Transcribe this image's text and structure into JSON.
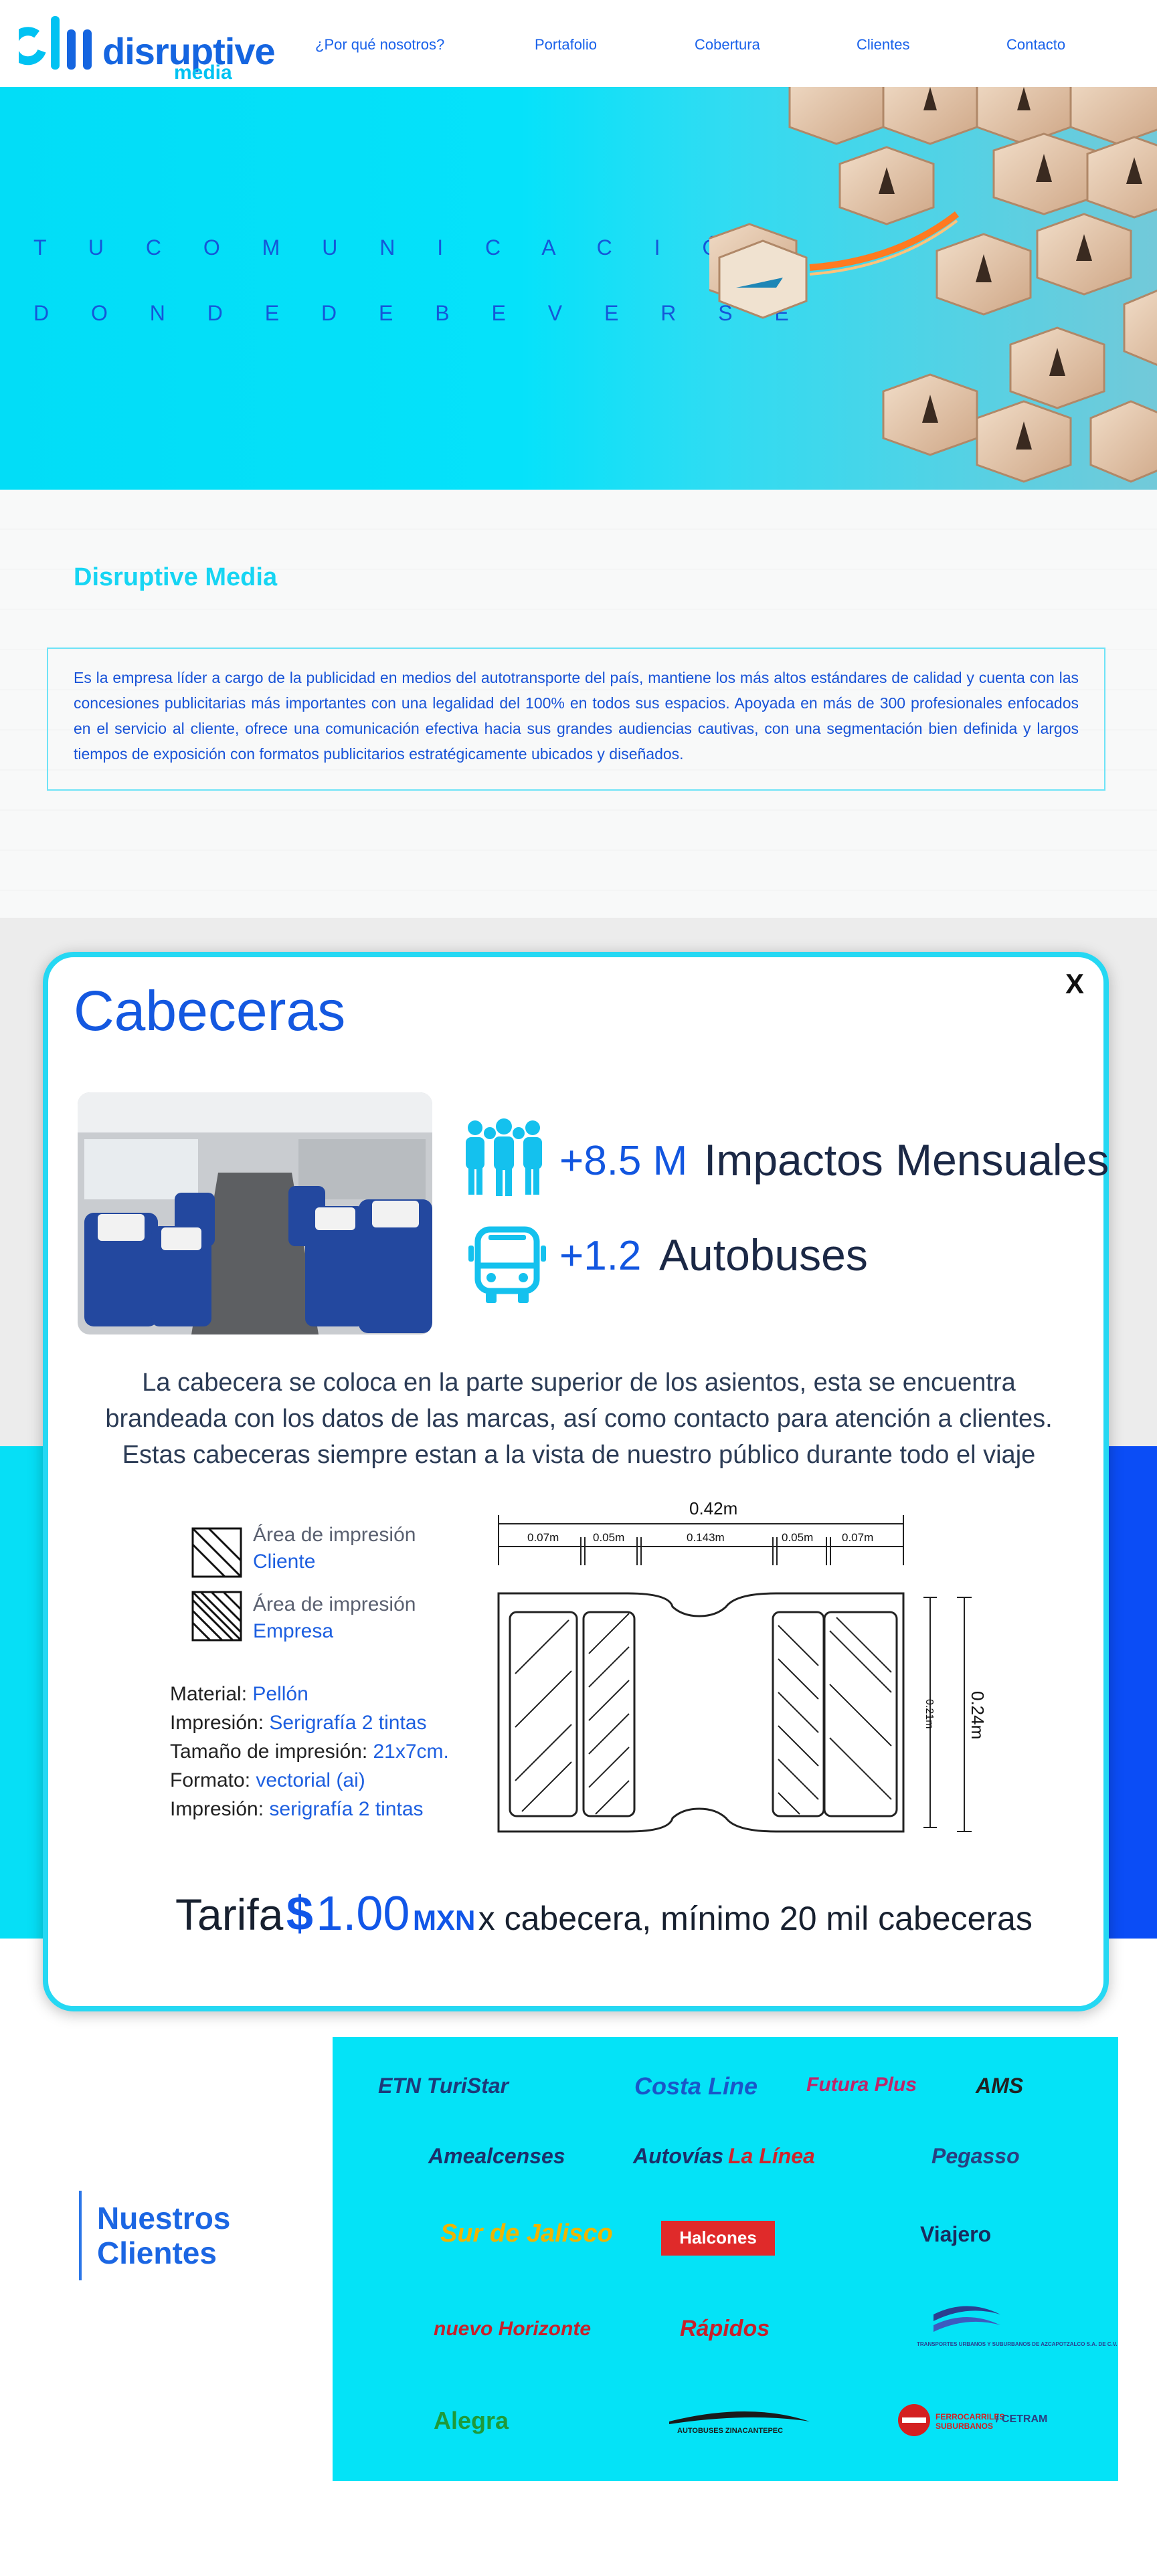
{
  "brand": {
    "name": "disruptive",
    "sub": "media"
  },
  "nav": {
    "items": [
      "¿Por qué nosotros?",
      "Portafolio",
      "Cobertura",
      "Clientes",
      "Contacto"
    ]
  },
  "hero": {
    "line1": "T U   C O M U N I C A C I Ó N",
    "line2": "D O N D E   D E B E   V E R S E"
  },
  "about": {
    "title": "Disruptive Media",
    "text": "Es la empresa líder a cargo de la publicidad en medios del  autotransporte del país, mantiene los más altos estándares de calidad y cuenta con las concesiones publicitarias más importantes  con una legalidad del 100% en todos sus espacios. Apoyada en más de 300 profesionales enfocados en el servicio al cliente, ofrece una comunicación efectiva hacia sus grandes audiencias cautivas, con una segmentación bien definida y largos tiempos de exposición con formatos publicitarios estratégicamente ubicados y diseñados."
  },
  "modal": {
    "close": "X",
    "title": "Cabeceras",
    "stats": [
      {
        "value": "+8.5 M",
        "label": "Impactos Mensuales",
        "icon": "people-group-icon"
      },
      {
        "value": "+1.2",
        "label": "Autobuses",
        "icon": "bus-icon"
      }
    ],
    "description": "La cabecera se coloca en la parte superior de los asientos, esta se encuentra brandeada con los datos de las marcas, así como contacto para atención a clientes. Estas cabeceras siempre estan a la vista de nuestro público durante todo el viaje",
    "legend": [
      {
        "label": "Área de impresión",
        "value": "Cliente"
      },
      {
        "label": "Área de impresión",
        "value": "Empresa"
      }
    ],
    "specs": [
      {
        "label": "Material: ",
        "value": "Pellón"
      },
      {
        "label": "Impresión: ",
        "value": "Serigrafía 2 tintas"
      },
      {
        "label": "Tamaño de impresión: ",
        "value": "21x7cm."
      },
      {
        "label": "Formato: ",
        "value": "vectorial (ai)"
      },
      {
        "label": "Impresión: ",
        "value": "serigrafía 2 tintas"
      }
    ],
    "diagram": {
      "total_width": "0.42m",
      "segments": [
        "0.07m",
        "0.05m",
        "0.143m",
        "0.05m",
        "0.07m"
      ],
      "inner_height": "0.21m",
      "total_height": "0.24m"
    },
    "tarifa": {
      "label": "Tarifa",
      "currency": "$",
      "amount": "1.00",
      "unit": "MXN",
      "note": "x cabecera, mínimo 20 mil cabeceras"
    }
  },
  "clients": {
    "title_line1": "Nuestros",
    "title_line2": "Clientes",
    "logos": [
      {
        "text": "ETN TuriStar",
        "color": "#1d3a7a"
      },
      {
        "text": "Costa Line",
        "color": "#1a56c8"
      },
      {
        "text": "Futura Plus",
        "color": "#c0256a"
      },
      {
        "text": "AMS",
        "color": "#222222"
      },
      {
        "text": "Amealcenses",
        "color": "#1c2f6a"
      },
      {
        "text": "Autovías",
        "color": "#1c2f6a"
      },
      {
        "text": "La Línea",
        "color": "#d0242c"
      },
      {
        "text": "Pegasso",
        "color": "#2a3f80"
      },
      {
        "text": "Sur de Jalisco",
        "color": "#f0b400"
      },
      {
        "text": "Halcones",
        "color": "#ffffff"
      },
      {
        "text": "Viajero",
        "color": "#1a2b5e"
      },
      {
        "text": "nuevo Horizonte",
        "color": "#c8202a"
      },
      {
        "text": "Rápidos",
        "color": "#c8202a"
      },
      {
        "text": "TRANSPORTES URBANOS Y SUBURBANOS DE AZCAPOTZALCO S.A. DE C.V.",
        "color": "#2a3f90"
      },
      {
        "text": "Alegra",
        "color": "#1e9a3a"
      },
      {
        "text": "AUTOBUSES ZINACANTEPEC",
        "color": "#1a1a1a"
      },
      {
        "text": "FERROCARRILES SUBURBANOS",
        "color": "#d42020"
      },
      {
        "text": "/ CETRAM",
        "color": "#2a3f80"
      }
    ]
  },
  "colors": {
    "brand_blue": "#1565e0",
    "accent_cyan": "#00c2f2",
    "hero_cyan": "#05e2fa",
    "side_blue": "#0b4df6"
  }
}
